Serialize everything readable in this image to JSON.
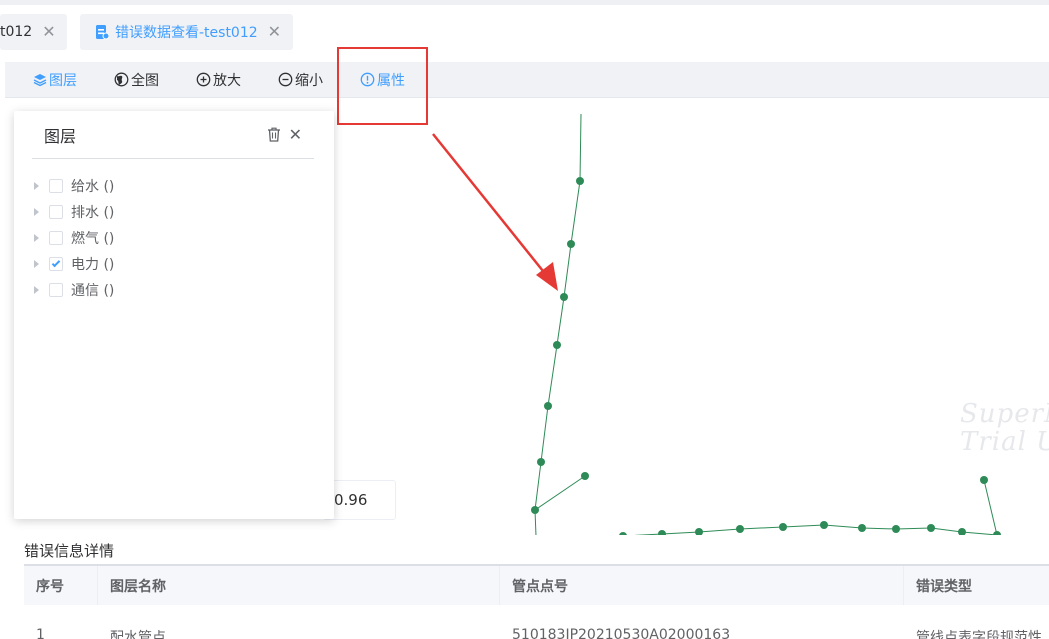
{
  "tabs": [
    {
      "label": "t012",
      "close": "✕"
    },
    {
      "label": "错误数据查看-test012",
      "close": "✕"
    }
  ],
  "toolbar": {
    "layers": "图层",
    "full_extent": "全图",
    "zoom_in": "放大",
    "zoom_out": "缩小",
    "attributes": "属性"
  },
  "layer_panel": {
    "title": "图层",
    "close": "✕",
    "items": [
      {
        "label": "给水 ()",
        "checked": false
      },
      {
        "label": "排水 ()",
        "checked": false
      },
      {
        "label": "燃气 ()",
        "checked": false
      },
      {
        "label": "电力 ()",
        "checked": true
      },
      {
        "label": "通信 ()",
        "checked": false
      }
    ]
  },
  "map": {
    "scale_text": "0.96",
    "watermark_line1": "SuperM",
    "watermark_line2": "Trial U",
    "line_color": "#2e8b57"
  },
  "error_detail": {
    "title": "错误信息详情",
    "columns": [
      "序号",
      "图层名称",
      "管点点号",
      "错误类型"
    ],
    "rows": [
      [
        "1",
        "配水管点",
        "510183JP20210530A02000163",
        "管线点表字段规范性"
      ]
    ]
  },
  "colors": {
    "accent": "#409eff",
    "annotation_red": "#e53935",
    "node_green": "#2e8b57"
  }
}
